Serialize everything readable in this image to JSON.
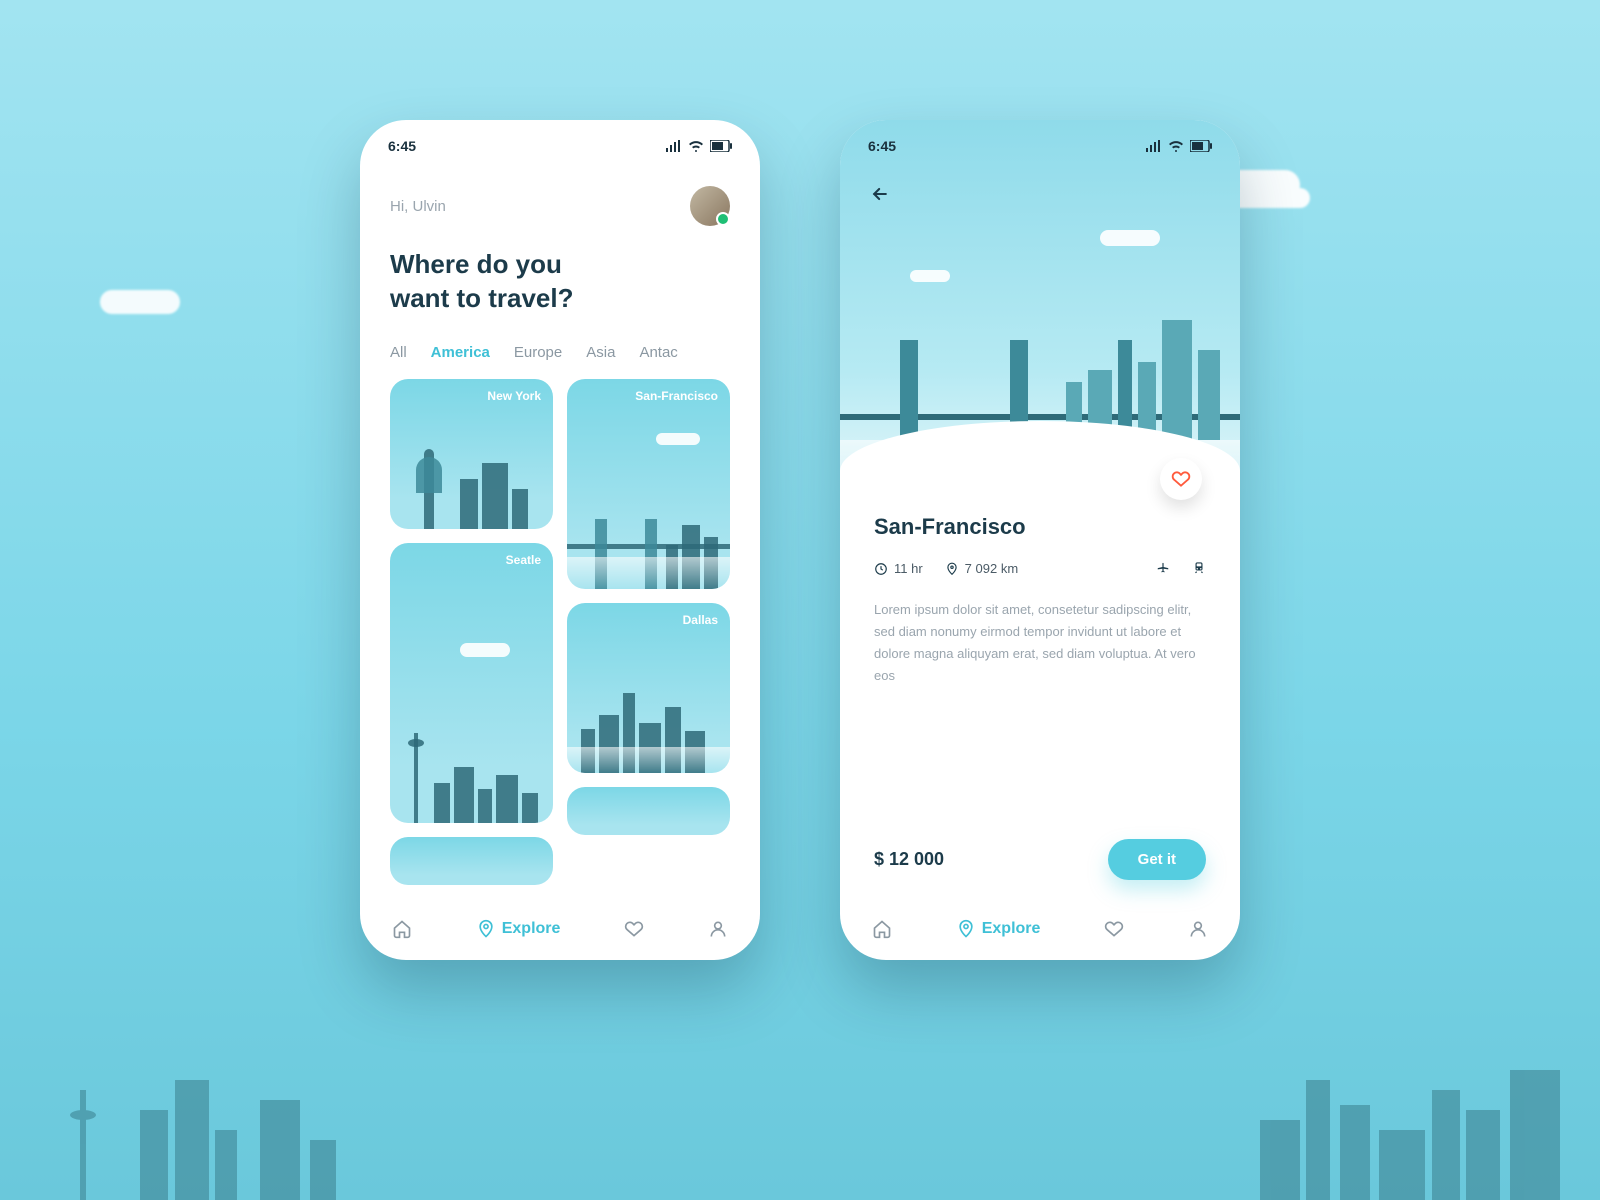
{
  "status_bar": {
    "time": "6:45"
  },
  "screen1": {
    "greeting": "Hi, Ulvin",
    "headline_l1": "Where do you",
    "headline_l2": "want to travel?",
    "tabs": [
      "All",
      "America",
      "Europe",
      "Asia",
      "Antac"
    ],
    "active_tab_index": 1,
    "cards": {
      "newyork": "New York",
      "sanfrancisco": "San-Francisco",
      "seatle": "Seatle",
      "dallas": "Dallas"
    }
  },
  "screen2": {
    "title": "San-Francisco",
    "duration": "11 hr",
    "distance": "7 092 km",
    "description": "Lorem ipsum dolor sit amet, consetetur sadipscing elitr, sed diam nonumy eirmod tempor invidunt ut labore et dolore magna aliquyam erat, sed diam voluptua. At vero eos",
    "price": "$ 12 000",
    "cta": "Get it"
  },
  "nav": {
    "explore": "Explore"
  }
}
